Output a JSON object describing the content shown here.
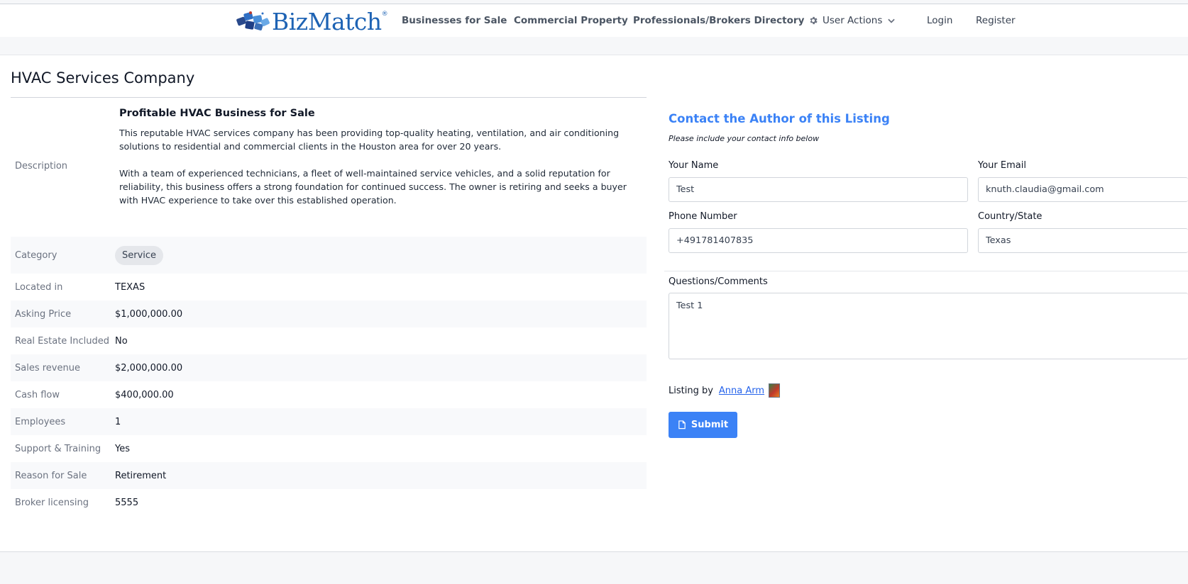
{
  "header": {
    "logo_text": "BizMatch",
    "logo_mark": "®",
    "nav": {
      "businesses": "Businesses for Sale",
      "commercial": "Commercial Property",
      "professionals": "Professionals/Brokers Directory",
      "user_actions": "User Actions",
      "login": "Login",
      "register": "Register"
    }
  },
  "listing": {
    "title": "HVAC Services Company",
    "description_label": "Description",
    "headline": "Profitable HVAC Business for Sale",
    "paragraphs": [
      "This reputable HVAC services company has been providing top-quality heating, ventilation, and air conditioning solutions to residential and commercial clients in the Houston area for over 20 years.",
      "With a team of experienced technicians, a fleet of well-maintained service vehicles, and a solid reputation for reliability, this business offers a strong foundation for continued success. The owner is retiring and seeks a buyer with HVAC experience to take over this established operation."
    ],
    "details": [
      {
        "label": "Category",
        "value": "Service"
      },
      {
        "label": "Located in",
        "value": "TEXAS"
      },
      {
        "label": "Asking Price",
        "value": "$1,000,000.00"
      },
      {
        "label": "Real Estate Included",
        "value": "No"
      },
      {
        "label": "Sales revenue",
        "value": "$2,000,000.00"
      },
      {
        "label": "Cash flow",
        "value": "$400,000.00"
      },
      {
        "label": "Employees",
        "value": "1"
      },
      {
        "label": "Support & Training",
        "value": "Yes"
      },
      {
        "label": "Reason for Sale",
        "value": "Retirement"
      },
      {
        "label": "Broker licensing",
        "value": "5555"
      }
    ]
  },
  "contact": {
    "title": "Contact the Author of this Listing",
    "subtitle": "Please include your contact info below",
    "name_label": "Your Name",
    "name_value": "Test",
    "email_label": "Your Email",
    "email_value": "knuth.claudia@gmail.com",
    "phone_label": "Phone Number",
    "phone_value": "+491781407835",
    "state_label": "Country/State",
    "state_value": "Texas",
    "comments_label": "Questions/Comments",
    "comments_value": "Test 1",
    "listing_by_label": "Listing by",
    "author_name": "Anna Arm",
    "submit_label": "Submit"
  },
  "colors": {
    "accent": "#3b82f6",
    "brand": "#1e63b4",
    "link": "#2563eb"
  }
}
